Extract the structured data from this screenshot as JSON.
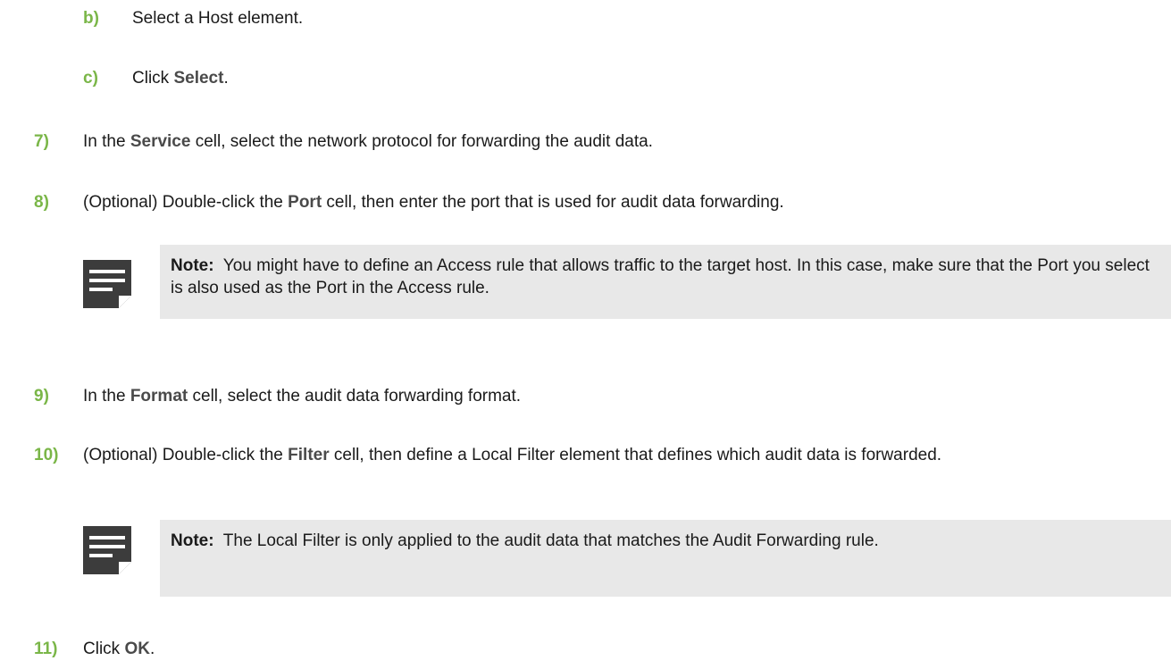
{
  "steps": [
    {
      "num": "b)",
      "before": "Select a Host element.",
      "bold": "",
      "after": ""
    },
    {
      "num": "c)",
      "before": "Click ",
      "bold": "Select",
      "after": "."
    },
    {
      "num": "7)",
      "before": "In the ",
      "bold": "Service",
      "after": " cell, select the network protocol for forwarding the audit data."
    },
    {
      "num": "8)",
      "before": "(Optional) Double-click the ",
      "bold": "Port",
      "after": " cell, then enter the port that is used for audit data forwarding."
    },
    {
      "num": "9)",
      "before": "In the ",
      "bold": "Format",
      "after": " cell, select the audit data forwarding format."
    },
    {
      "num": "10)",
      "before": "(Optional) Double-click the ",
      "bold": "Filter",
      "after": " cell, then define a Local Filter element that defines which audit data is forwarded."
    },
    {
      "num": "11)",
      "before": "Click ",
      "bold": "OK",
      "after": "."
    }
  ],
  "notes": [
    {
      "label": "Note:",
      "text": "You might have to define an Access rule that allows traffic to the target host. In this case, make sure that the Port you select is also used as the Port in the Access rule.",
      "icon": "note-icon"
    },
    {
      "label": "Note:",
      "text": "The Local Filter is only applied to the audit data that matches the Audit Forwarding rule.",
      "icon": "note-icon"
    }
  ]
}
